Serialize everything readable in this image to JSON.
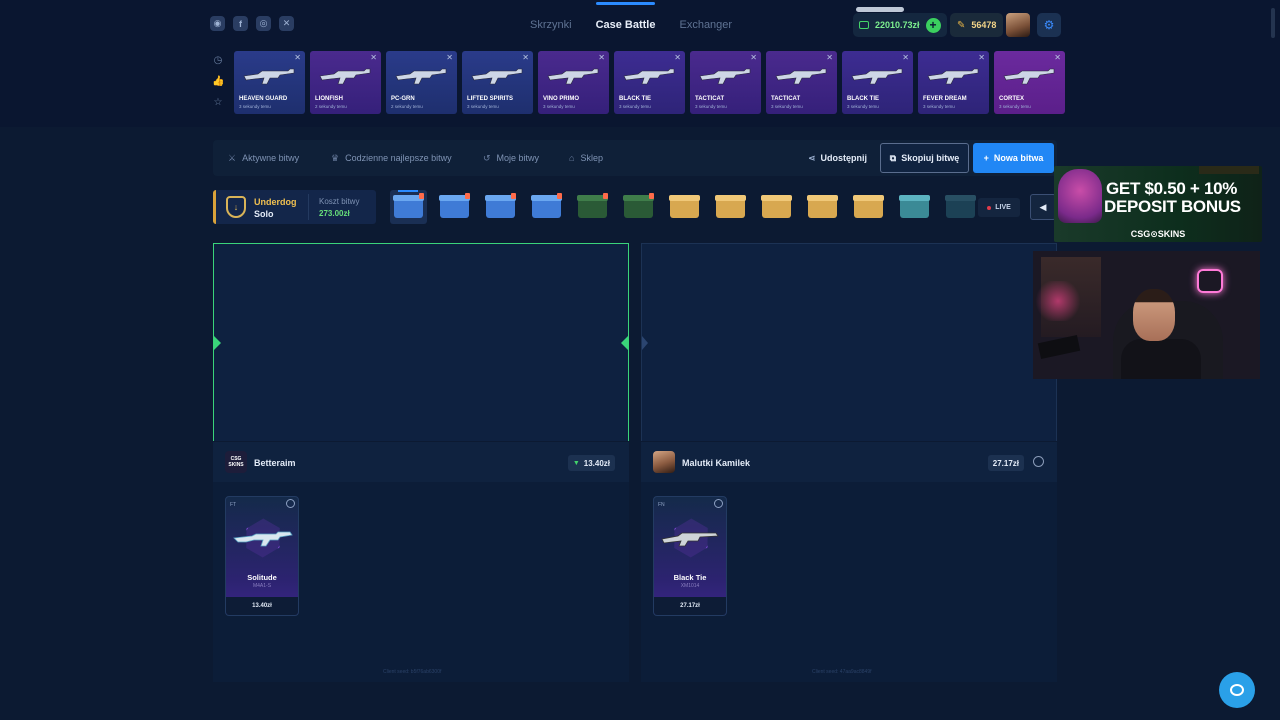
{
  "header": {
    "social": [
      "discord-icon",
      "facebook-icon",
      "instagram-icon",
      "x-icon"
    ],
    "nav": [
      {
        "label": "Skrzynki",
        "active": false
      },
      {
        "label": "Case Battle",
        "active": true
      },
      {
        "label": "Exchanger",
        "active": false
      }
    ],
    "balance": "22010.73zł",
    "coins": "56478"
  },
  "drops": [
    {
      "name": "HEAVEN GUARD",
      "sub": "3 sekundy temu",
      "rarity": "blue"
    },
    {
      "name": "LIONFISH",
      "sub": "2 sekundy temu",
      "rarity": "purple"
    },
    {
      "name": "PC-GRN",
      "sub": "2 sekundy temu",
      "rarity": "blue"
    },
    {
      "name": "LIFTED SPIRITS",
      "sub": "3 sekundy temu",
      "rarity": "blue"
    },
    {
      "name": "VINO PRIMO",
      "sub": "3 sekundy temu",
      "rarity": "purple"
    },
    {
      "name": "BLACK TIE",
      "sub": "3 sekundy temu",
      "rarity": "violet"
    },
    {
      "name": "TACTICAT",
      "sub": "3 sekundy temu",
      "rarity": "purple"
    },
    {
      "name": "TACTICAT",
      "sub": "3 sekundy temu",
      "rarity": "purple"
    },
    {
      "name": "BLACK TIE",
      "sub": "3 sekundy temu",
      "rarity": "violet"
    },
    {
      "name": "FEVER DREAM",
      "sub": "3 sekundy temu",
      "rarity": "violet"
    },
    {
      "name": "CORTEX",
      "sub": "3 sekundy temu",
      "rarity": "pink"
    }
  ],
  "battle_nav": {
    "active": "Aktywne bitwy",
    "daily": "Codzienne najlepsze bitwy",
    "mine": "Moje bitwy",
    "shop": "Sklep",
    "share": "Udostępnij",
    "copy": "Skopiuj bitwę",
    "new": "Nowa bitwa"
  },
  "battle": {
    "mode": "Underdog",
    "type": "Solo",
    "cost_label": "Koszt bitwy",
    "cost": "273.00zł",
    "live": "LIVE",
    "cases": [
      "blue",
      "blue",
      "blue",
      "blue",
      "green",
      "green",
      "gold",
      "gold",
      "gold",
      "gold",
      "gold",
      "teal",
      "teal"
    ]
  },
  "players": [
    {
      "name": "Betteraim",
      "total": "13.40zł",
      "item": {
        "wear": "FT",
        "name": "Solitude",
        "type": "M4A1-S",
        "price": "13.40zł"
      },
      "seed": "Client seed: b5f76ab6300f"
    },
    {
      "name": "Malutki Kamilek",
      "total": "27.17zł",
      "item": {
        "wear": "FN",
        "name": "Black Tie",
        "type": "XM1014",
        "price": "27.17zł"
      },
      "seed": "Client seed: 47aa9ac8849f"
    }
  ],
  "promo": {
    "line1": "GET $0.50 + 10%",
    "line2": "DEPOSIT BONUS",
    "brand": "CSG⊙SKINS"
  }
}
